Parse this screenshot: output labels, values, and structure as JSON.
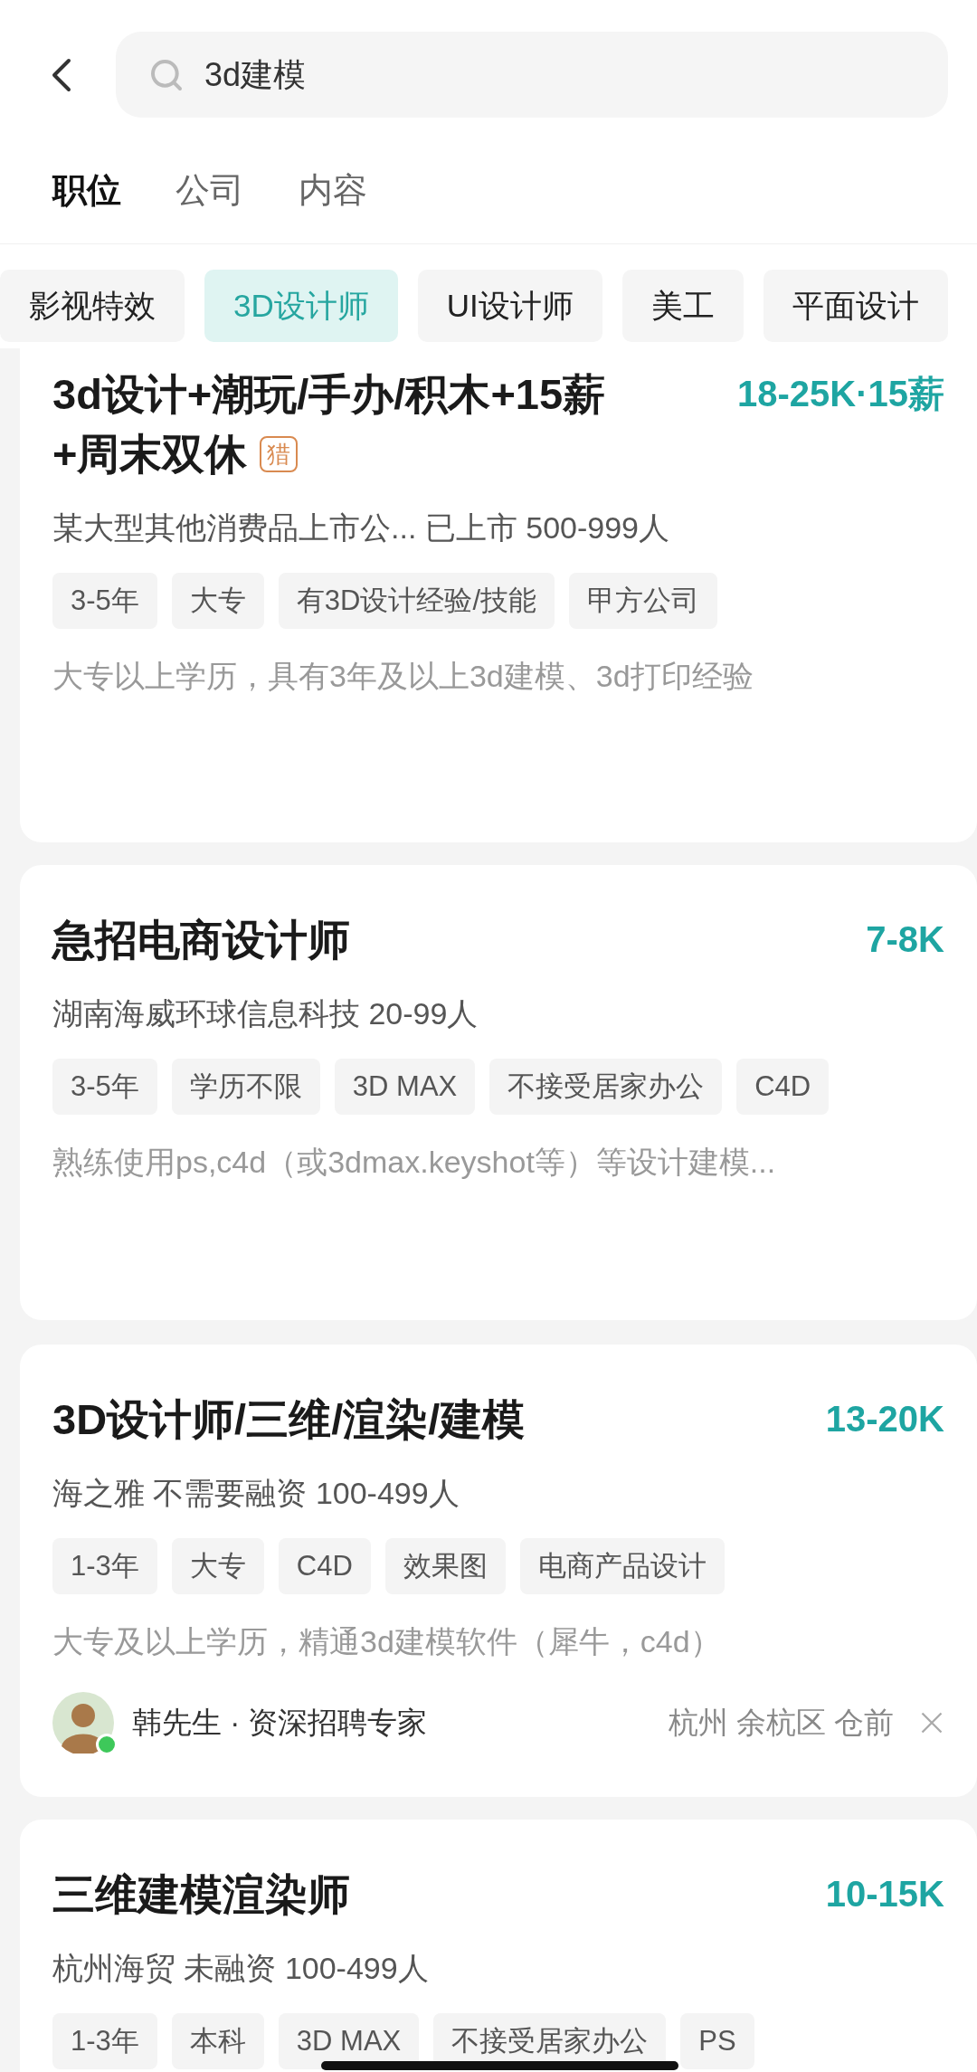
{
  "search": {
    "value": "3d建模"
  },
  "tabs": [
    {
      "label": "职位",
      "selected": true
    },
    {
      "label": "公司",
      "selected": false
    },
    {
      "label": "内容",
      "selected": false
    }
  ],
  "categories": [
    {
      "label": "影视特效",
      "selected": false
    },
    {
      "label": "3D设计师",
      "selected": true
    },
    {
      "label": "UI设计师",
      "selected": false
    },
    {
      "label": "美工",
      "selected": false
    },
    {
      "label": "平面设计",
      "selected": false
    }
  ],
  "jobs": [
    {
      "title": [
        "3d设计+潮玩/手办/积木+15薪",
        "+周末双休"
      ],
      "badge": "猎",
      "salary": "18-25K·15薪",
      "company": "某大型其他消费品上市公... 已上市 500-999人",
      "tags": [
        "3-5年",
        "大专",
        "有3D设计经验/技能",
        "甲方公司"
      ],
      "description": "大专以上学历，具有3年及以上3d建模、3d打印经验"
    },
    {
      "title": [
        "急招电商设计师"
      ],
      "salary": "7-8K",
      "company": "湖南海威环球信息科技 20-99人",
      "tags": [
        "3-5年",
        "学历不限",
        "3D MAX",
        "不接受居家办公",
        "C4D"
      ],
      "description": "熟练使用ps,c4d（或3dmax.keyshot等）等设计建模..."
    },
    {
      "title": [
        "3D设计师/三维/渲染/建模"
      ],
      "salary": "13-20K",
      "company": "海之雅 不需要融资 100-499人",
      "tags": [
        "1-3年",
        "大专",
        "C4D",
        "效果图",
        "电商产品设计"
      ],
      "description": "大专及以上学历，精通3d建模软件（犀牛，c4d）",
      "recruiter": {
        "name": "韩先生 · 资深招聘专家",
        "online": true,
        "location": "杭州 余杭区 仓前"
      }
    },
    {
      "title": [
        "三维建模渲染师"
      ],
      "salary": "10-15K",
      "company": "杭州海贸 未融资 100-499人",
      "tags": [
        "1-3年",
        "本科",
        "3D MAX",
        "不接受居家办公",
        "PS"
      ]
    }
  ]
}
